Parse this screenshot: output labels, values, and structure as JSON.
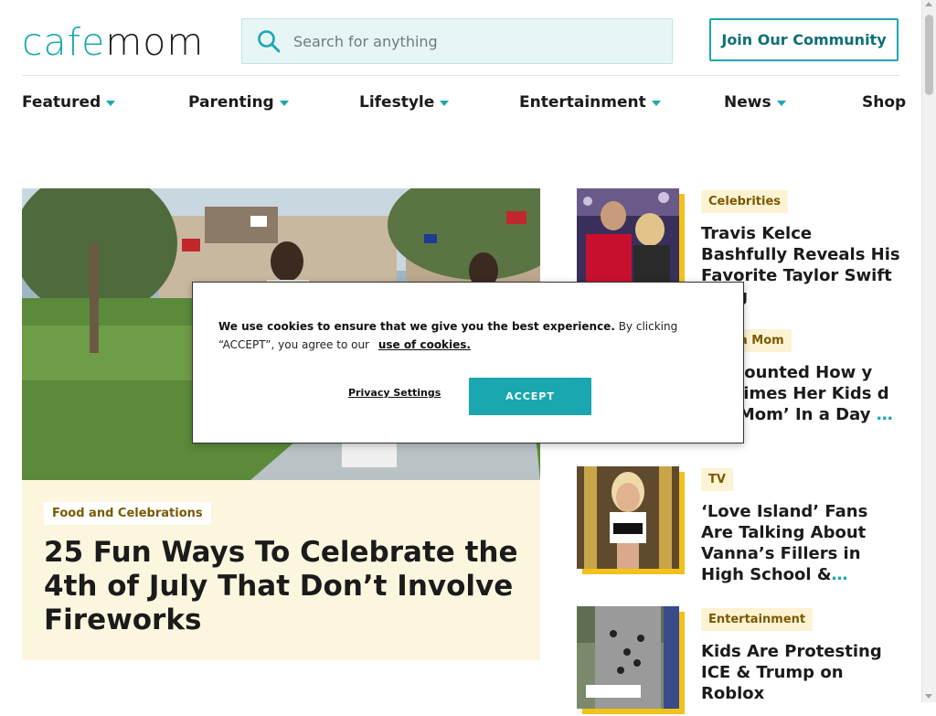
{
  "header": {
    "logo_cafe": "cafe",
    "logo_mom": "mom",
    "search_placeholder": "Search for anything",
    "join_label": "Join Our Community"
  },
  "nav": {
    "items": [
      {
        "label": "Featured",
        "has_caret": true
      },
      {
        "label": "Parenting",
        "has_caret": true
      },
      {
        "label": "Lifestyle",
        "has_caret": true
      },
      {
        "label": "Entertainment",
        "has_caret": true
      },
      {
        "label": "News",
        "has_caret": true
      },
      {
        "label": "Shop",
        "has_caret": false
      }
    ]
  },
  "featured": {
    "category": "Food and Celebrations",
    "title": "25 Fun Ways To Celebrate the 4th of July That Don’t Involve Fireworks"
  },
  "sidebar": {
    "articles": [
      {
        "category": "Celebrities",
        "title": "Travis Kelce Bashfully Reveals His Favorite Taylor Swift Song",
        "ellipsis": ""
      },
      {
        "category": "a Mom",
        "title": "Counted How y Times Her Kids d ‘Mom’ In a Day",
        "ellipsis": "…"
      },
      {
        "category": "TV",
        "title": "‘Love Island’ Fans Are Talking About Vanna’s Fillers in High School &",
        "ellipsis": "…"
      },
      {
        "category": "Entertainment",
        "title": "Kids Are Protesting ICE & Trump on Roblox",
        "ellipsis": ""
      }
    ]
  },
  "cookie": {
    "bold_text": "We use cookies to ensure that we give you the best experience.",
    "text": "By clicking “ACCEPT”, you agree to our",
    "link": "use of cookies.",
    "privacy_label": "Privacy Settings",
    "accept_label": "ACCEPT"
  },
  "colors": {
    "accent": "#1aa7b0",
    "tag_background": "#fdf3d3",
    "thumb_shadow": "#f2c21b",
    "card_background": "#fdf6df"
  }
}
